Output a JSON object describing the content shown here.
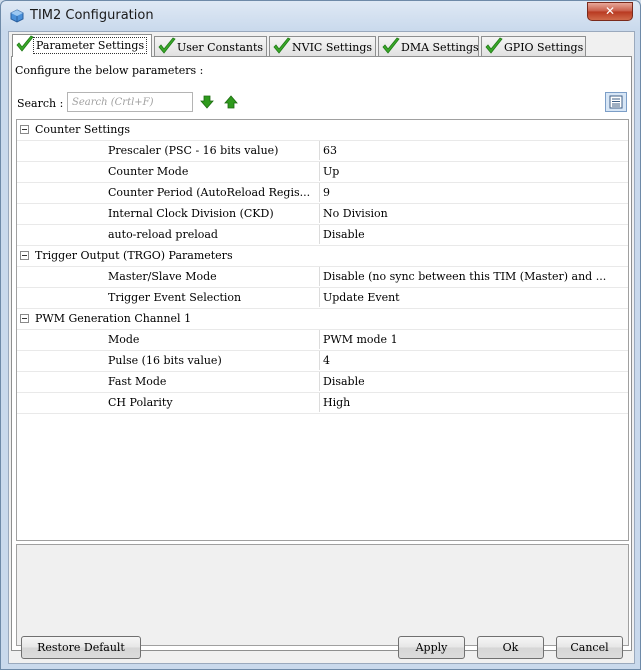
{
  "window": {
    "title": "TIM2 Configuration",
    "close_glyph": "✕"
  },
  "tabs": [
    {
      "label": "Parameter Settings",
      "active": true
    },
    {
      "label": "User Constants",
      "active": false
    },
    {
      "label": "NVIC Settings",
      "active": false
    },
    {
      "label": "DMA Settings",
      "active": false
    },
    {
      "label": "GPIO Settings",
      "active": false
    }
  ],
  "panel": {
    "configure_text": "Configure the below parameters :",
    "search_label": "Search :",
    "search_placeholder": "Search (Crtl+F)",
    "search_value": ""
  },
  "groups": [
    {
      "name": "Counter Settings",
      "params": [
        {
          "name": "Prescaler (PSC - 16 bits value)",
          "value": "63"
        },
        {
          "name": "Counter Mode",
          "value": "Up"
        },
        {
          "name": "Counter Period (AutoReload Regis...",
          "value": "9"
        },
        {
          "name": "Internal Clock Division (CKD)",
          "value": "No Division"
        },
        {
          "name": "auto-reload preload",
          "value": "Disable"
        }
      ]
    },
    {
      "name": "Trigger Output (TRGO) Parameters",
      "params": [
        {
          "name": "Master/Slave Mode",
          "value": "Disable (no sync between this TIM (Master) and ..."
        },
        {
          "name": "Trigger Event Selection",
          "value": "Update Event"
        }
      ]
    },
    {
      "name": "PWM Generation Channel 1",
      "params": [
        {
          "name": "Mode",
          "value": "PWM mode 1"
        },
        {
          "name": "Pulse (16 bits value)",
          "value": "4"
        },
        {
          "name": "Fast Mode",
          "value": "Disable"
        },
        {
          "name": "CH Polarity",
          "value": "High"
        }
      ]
    }
  ],
  "buttons": {
    "restore_default": "Restore Default",
    "apply": "Apply",
    "ok": "Ok",
    "cancel": "Cancel"
  },
  "icons": {
    "tab_check": "check-icon",
    "search_next": "arrow-down-icon",
    "search_prev": "arrow-up-icon",
    "list_view": "list-view-icon",
    "app": "cube-icon"
  },
  "colors": {
    "check_green": "#3aa82a",
    "arrow_green": "#2e9a1c",
    "close_red": "#c75a45"
  }
}
